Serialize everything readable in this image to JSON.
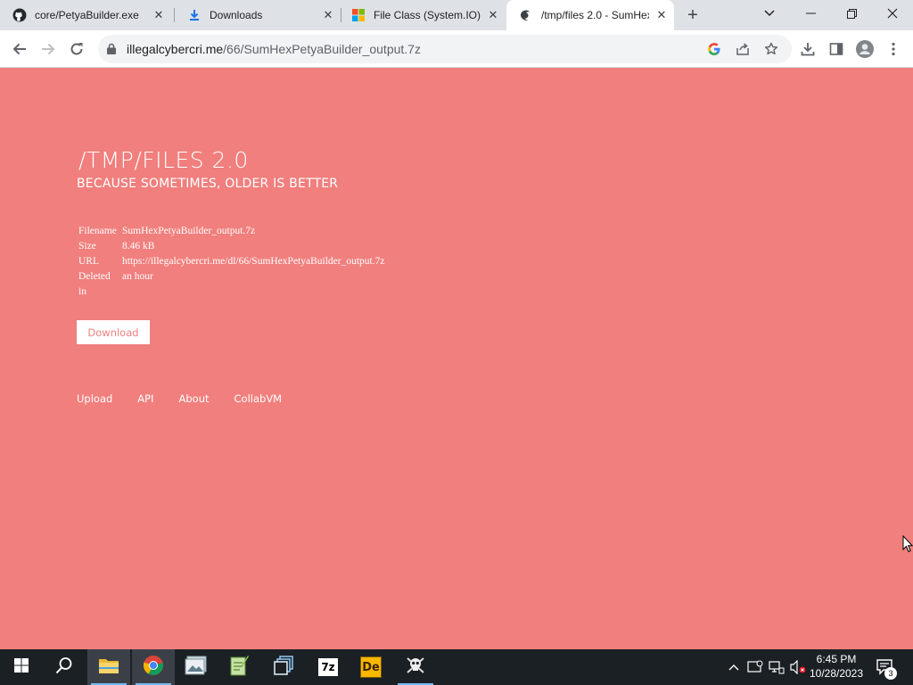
{
  "browser": {
    "tabs": [
      {
        "title": "core/PetyaBuilder.exe",
        "icon": "github-icon"
      },
      {
        "title": "Downloads",
        "icon": "download-icon"
      },
      {
        "title": "File Class (System.IO) |",
        "icon": "microsoft-icon"
      },
      {
        "title": "/tmp/files 2.0 - SumHex",
        "icon": "site-icon"
      }
    ],
    "new_tab_label": "+",
    "url_host": "illegalcybercri.me",
    "url_path": "/66/SumHexPetyaBuilder_output.7z"
  },
  "page": {
    "title": "/TMP/FILES 2.0",
    "subtitle": "BECAUSE SOMETIMES, OLDER IS BETTER",
    "info": {
      "filename_label": "Filename",
      "filename_value": "SumHexPetyaBuilder_output.7z",
      "size_label": "Size",
      "size_value": "8.46 kB",
      "url_label": "URL",
      "url_value": "https://illegalcybercri.me/dl/66/SumHexPetyaBuilder_output.7z",
      "deleted_label": "Deleted in",
      "deleted_value": "an hour"
    },
    "download_label": "Download",
    "footer_links": [
      "Upload",
      "API",
      "About",
      "CollabVM"
    ]
  },
  "taskbar": {
    "time": "6:45 PM",
    "date": "10/28/2023",
    "notification_count": "3",
    "app_7z_label": "7z",
    "app_de_label": "De"
  },
  "colors": {
    "page_background": "#f07f7d",
    "text": "#ffffff"
  }
}
